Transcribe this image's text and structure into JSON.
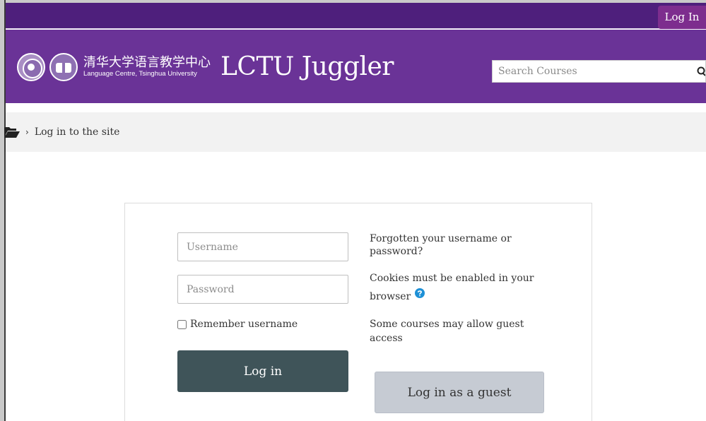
{
  "topbar": {
    "login_label": "Log In"
  },
  "header": {
    "logo_cn": "清华大学语言教学中心",
    "logo_en": "Language Centre, Tsinghua University",
    "site_name": "LCTU Juggler",
    "search_placeholder": "Search Courses"
  },
  "breadcrumb": {
    "items": [
      "Log in to the site"
    ]
  },
  "login": {
    "username_placeholder": "Username",
    "password_placeholder": "Password",
    "remember_label": "Remember username",
    "login_button": "Log in",
    "forgot_link": "Forgotten your username or password?",
    "cookies_note": "Cookies must be enabled in your browser",
    "guest_note": "Some courses may allow guest access",
    "guest_button": "Log in as a guest"
  },
  "colors": {
    "topbar": "#4e1f7c",
    "header": "#6a3397",
    "login_link_bg": "#7d2d8e",
    "login_button_bg": "#3f5459",
    "guest_button_bg": "#c6cbd3",
    "help_icon": "#1e90d6"
  },
  "icons": {
    "breadcrumb_home": "folder-open-icon",
    "search": "search-icon",
    "help": "question-circle-icon"
  }
}
